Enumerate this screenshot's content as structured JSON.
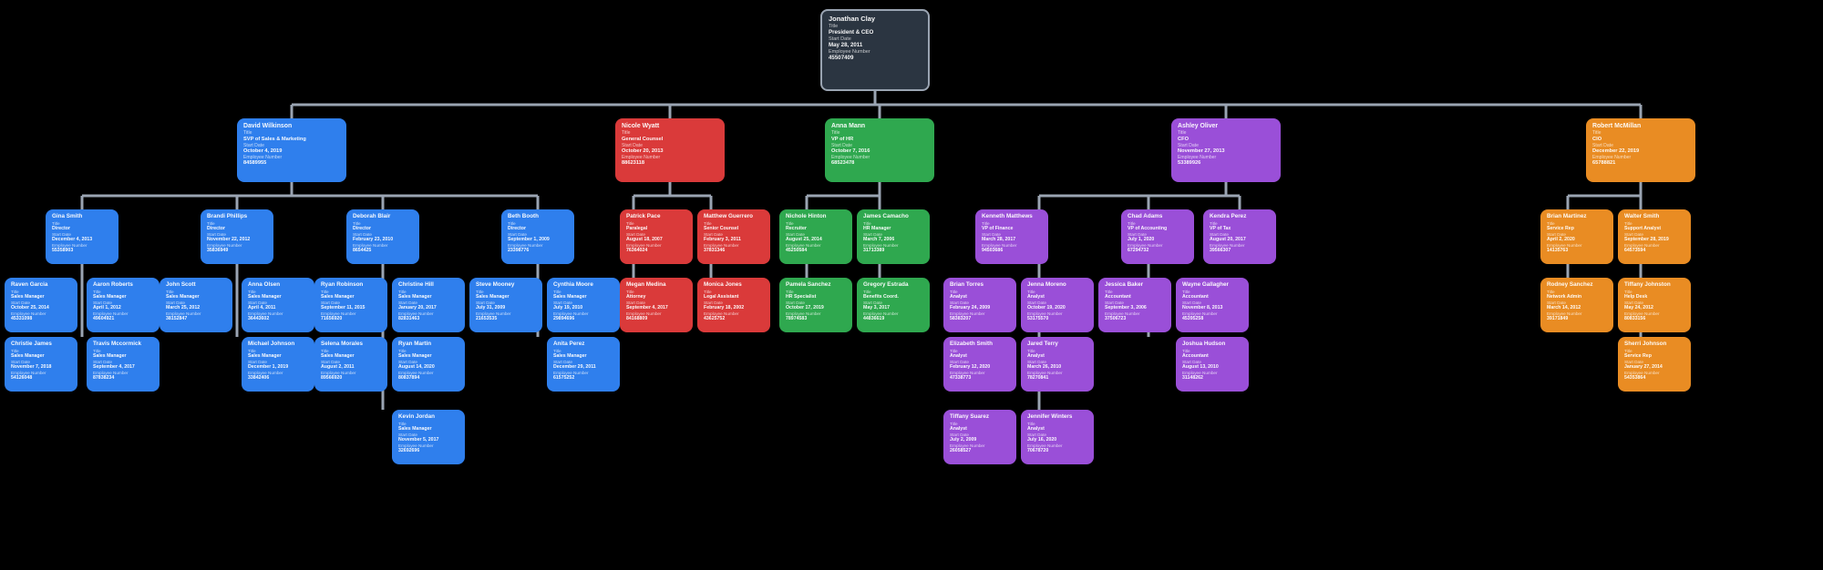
{
  "labels": {
    "title": "Title",
    "start": "Start Date",
    "emp": "Employee Number"
  },
  "root": {
    "name": "Jonathan Clay",
    "title": "President & CEO",
    "start": "May 28, 2011",
    "emp": "45507409"
  },
  "l1": [
    {
      "name": "David Wilkinson",
      "title": "SVP of Sales & Marketing",
      "start": "October 4, 2019",
      "emp": "84589955",
      "color": "blue"
    },
    {
      "name": "Nicole Wyatt",
      "title": "General Counsel",
      "start": "October 20, 2013",
      "emp": "88623118",
      "color": "red"
    },
    {
      "name": "Anna Mann",
      "title": "VP of HR",
      "start": "October 7, 2016",
      "emp": "68523478",
      "color": "green"
    },
    {
      "name": "Ashley Oliver",
      "title": "CFO",
      "start": "November 27, 2013",
      "emp": "53389926",
      "color": "purple"
    },
    {
      "name": "Robert McMillan",
      "title": "CIO",
      "start": "December 22, 2019",
      "emp": "65788821",
      "color": "orange"
    }
  ],
  "wilkinson": [
    {
      "name": "Gina Smith",
      "title": "Director",
      "start": "December 4, 2013",
      "emp": "55358903"
    },
    {
      "name": "Brandi Phillips",
      "title": "Director",
      "start": "November 22, 2012",
      "emp": "35836949"
    },
    {
      "name": "Deborah Blair",
      "title": "Director",
      "start": "February 23, 2010",
      "emp": "8654425"
    },
    {
      "name": "Beth Booth",
      "title": "Director",
      "start": "September 1, 2009",
      "emp": "23398776"
    }
  ],
  "gina_kids": [
    {
      "name": "Raven Garcia",
      "title": "Sales Manager",
      "start": "October 25, 2014",
      "emp": "45331098"
    },
    {
      "name": "Aaron Roberts",
      "title": "Sales Manager",
      "start": "April 1, 2012",
      "emp": "49604921"
    },
    {
      "name": "Christie James",
      "title": "Sales Manager",
      "start": "November 7, 2018",
      "emp": "54126048"
    },
    {
      "name": "Travis Mccormick",
      "title": "Sales Manager",
      "start": "September 4, 2017",
      "emp": "87838234"
    }
  ],
  "brandi_kids": [
    {
      "name": "John Scott",
      "title": "Sales Manager",
      "start": "March 25, 2012",
      "emp": "38152847"
    },
    {
      "name": "Anna Olsen",
      "title": "Sales Manager",
      "start": "April 4, 2011",
      "emp": "36443602"
    },
    {
      "name": "Michael Johnson",
      "title": "Sales Manager",
      "start": "December 1, 2019",
      "emp": "33842406"
    }
  ],
  "deborah_kids": [
    {
      "name": "Ryan Robinson",
      "title": "Sales Manager",
      "start": "September 11, 2015",
      "emp": "71656920"
    },
    {
      "name": "Christine Hill",
      "title": "Sales Manager",
      "start": "January 20, 2017",
      "emp": "82831463"
    },
    {
      "name": "Selena Morales",
      "title": "Sales Manager",
      "start": "August 2, 2011",
      "emp": "89566920"
    },
    {
      "name": "Ryan Martin",
      "title": "Sales Manager",
      "start": "August 14, 2020",
      "emp": "80837894"
    },
    {
      "name": "Kevin Jordan",
      "title": "Sales Manager",
      "start": "November 5, 2017",
      "emp": "32692696"
    }
  ],
  "beth_kids": [
    {
      "name": "Steve Mooney",
      "title": "Sales Manager",
      "start": "July 31, 2009",
      "emp": "21653535"
    },
    {
      "name": "Cynthia Moore",
      "title": "Sales Manager",
      "start": "July 19, 2010",
      "emp": "29894696"
    },
    {
      "name": "Anita Perez",
      "title": "Sales Manager",
      "start": "December 29, 2011",
      "emp": "61575252"
    }
  ],
  "wyatt_kids": [
    {
      "name": "Patrick Pace",
      "title": "Paralegal",
      "start": "August 18, 2007",
      "emp": "76364024"
    },
    {
      "name": "Matthew Guerrero",
      "title": "Senior Counsel",
      "start": "February 3, 2011",
      "emp": "37831346"
    },
    {
      "name": "Megan Medina",
      "title": "Attorney",
      "start": "September 4, 2017",
      "emp": "84168809"
    },
    {
      "name": "Monica Jones",
      "title": "Legal Assistant",
      "start": "February 18, 2002",
      "emp": "43625752"
    }
  ],
  "mann_kids": [
    {
      "name": "Nichole Hinton",
      "title": "Recruiter",
      "start": "August 25, 2014",
      "emp": "45250584"
    },
    {
      "name": "James Camacho",
      "title": "HR Manager",
      "start": "March 7, 2006",
      "emp": "31713389"
    },
    {
      "name": "Pamela Sanchez",
      "title": "HR Specialist",
      "start": "October 17, 2019",
      "emp": "78974583"
    },
    {
      "name": "Gregory Estrada",
      "title": "Benefits Coord.",
      "start": "May 3, 2017",
      "emp": "44836619"
    }
  ],
  "oliver_kids": [
    {
      "name": "Kenneth Matthews",
      "title": "VP of Finance",
      "start": "March 28, 2017",
      "emp": "94503686"
    },
    {
      "name": "Chad Adams",
      "title": "VP of Accounting",
      "start": "July 1, 2020",
      "emp": "67294732"
    },
    {
      "name": "Kendra Perez",
      "title": "VP of Tax",
      "start": "August 20, 2017",
      "emp": "39566307"
    }
  ],
  "kenneth_kids": [
    {
      "name": "Brian Torres",
      "title": "Analyst",
      "start": "February 24, 2009",
      "emp": "58383207"
    },
    {
      "name": "Jenna Moreno",
      "title": "Analyst",
      "start": "October 19, 2020",
      "emp": "53175570"
    },
    {
      "name": "Elizabeth Smith",
      "title": "Analyst",
      "start": "February 12, 2020",
      "emp": "47338773"
    },
    {
      "name": "Jared Terry",
      "title": "Analyst",
      "start": "March 26, 2010",
      "emp": "78270841"
    },
    {
      "name": "Tiffany Suarez",
      "title": "Analyst",
      "start": "July 2, 2009",
      "emp": "26058527"
    },
    {
      "name": "Jennifer Winters",
      "title": "Analyst",
      "start": "July 16, 2020",
      "emp": "70678720"
    }
  ],
  "chad_kids": [
    {
      "name": "Jessica Baker",
      "title": "Accountant",
      "start": "September 3, 2006",
      "emp": "37506723"
    },
    {
      "name": "Wayne Gallagher",
      "title": "Accountant",
      "start": "November 8, 2013",
      "emp": "45395258"
    },
    {
      "name": "Joshua Hudson",
      "title": "Accountant",
      "start": "August 13, 2010",
      "emp": "31148262"
    }
  ],
  "mcmillan_kids": [
    {
      "name": "Brian Martinez",
      "title": "Service Rep",
      "start": "April 2, 2020",
      "emp": "14135763"
    },
    {
      "name": "Walter Smith",
      "title": "Support Analyst",
      "start": "September 28, 2019",
      "emp": "64573594"
    },
    {
      "name": "Rodney Sanchez",
      "title": "Network Admin",
      "start": "March 14, 2012",
      "emp": "39171849"
    },
    {
      "name": "Tiffany Johnston",
      "title": "Help Desk",
      "start": "May 24, 2012",
      "emp": "80833156"
    },
    {
      "name": "Sherri Johnson",
      "title": "Service Rep",
      "start": "January 27, 2014",
      "emp": "54353864"
    }
  ]
}
